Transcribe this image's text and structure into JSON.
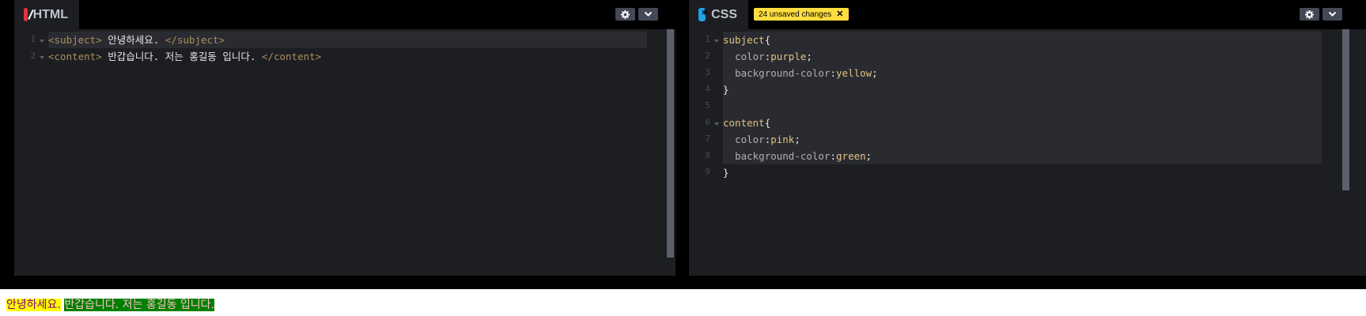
{
  "html_panel": {
    "title": "HTML",
    "badge_icon": "html-slash-icon",
    "lines": [
      {
        "num": "1",
        "open_tag": "<subject>",
        "text": " 안녕하세요. ",
        "close_tag": "</subject>"
      },
      {
        "num": "2",
        "open_tag": "<content>",
        "text": " 반갑습니다. 저는 홍길동 입니다. ",
        "close_tag": "</content>"
      }
    ]
  },
  "css_panel": {
    "title": "CSS",
    "badge_icon": "css-asterisk-icon",
    "unsaved_label": "24 unsaved changes",
    "line_numbers": [
      "1",
      "2",
      "3",
      "4",
      "5",
      "6",
      "7",
      "8",
      "9"
    ],
    "rules": [
      {
        "selector": "subject",
        "declarations": [
          {
            "property": "color",
            "value": "purple"
          },
          {
            "property": "background-color",
            "value": "yellow"
          }
        ]
      },
      {
        "selector": "content",
        "declarations": [
          {
            "property": "color",
            "value": "pink"
          },
          {
            "property": "background-color",
            "value": "green"
          }
        ]
      }
    ]
  },
  "output": {
    "subject_text": "안녕하세요.",
    "content_text": "반갑습니다. 저는 홍길동 입니다."
  },
  "colors": {
    "editor_bg": "#1d1e22",
    "unsaved_badge": "#ffdd40",
    "html_badge": "#e4343a",
    "css_badge": "#1aa4ea"
  }
}
